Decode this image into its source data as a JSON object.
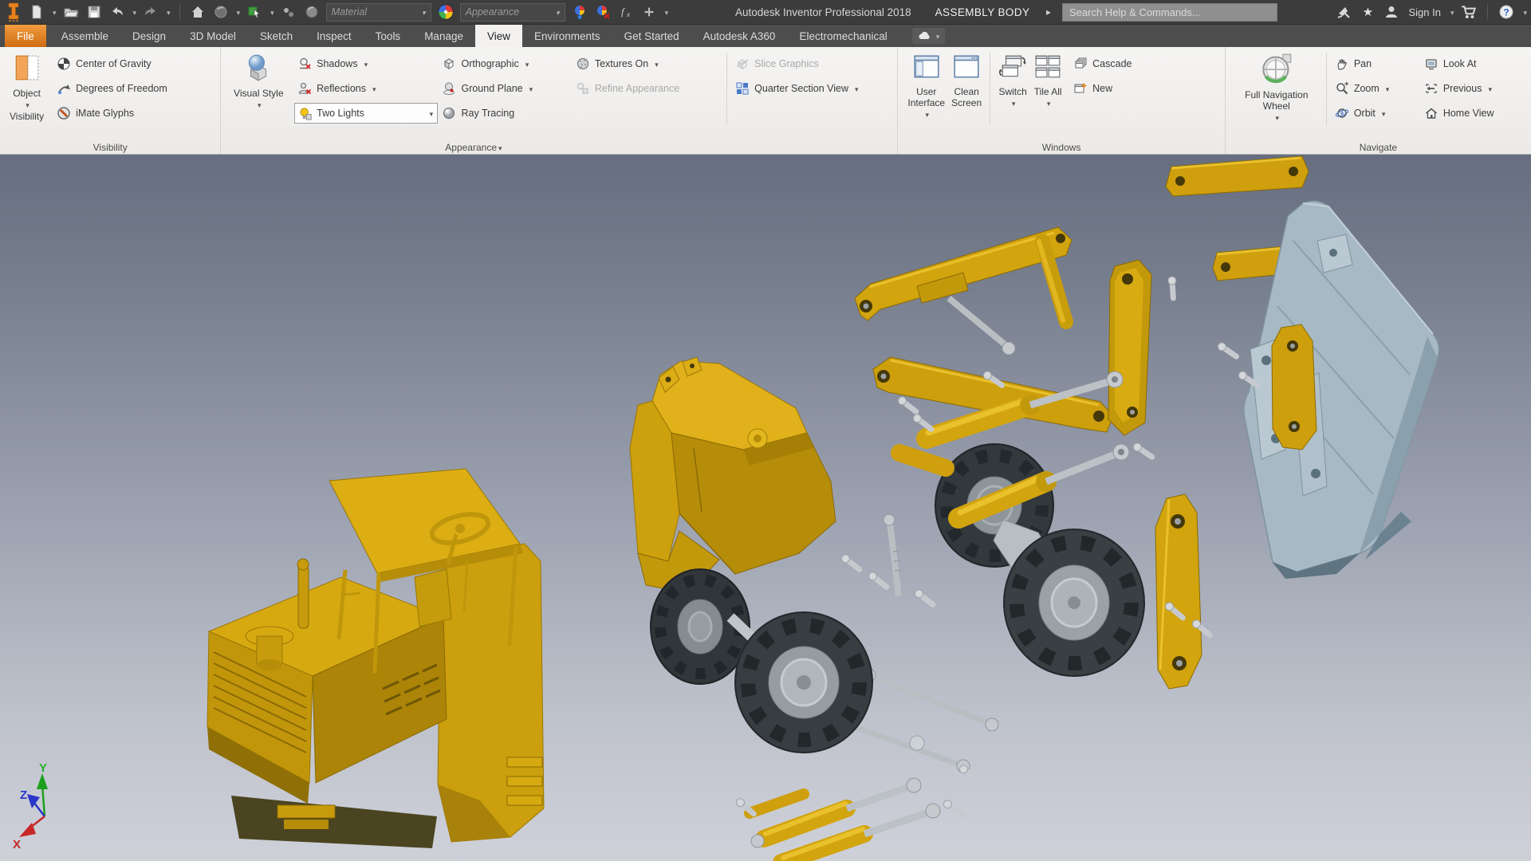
{
  "titlebar": {
    "title": "Autodesk Inventor Professional 2018",
    "document": "ASSEMBLY BODY",
    "search_placeholder": "Search Help & Commands...",
    "sign_in": "Sign In",
    "material_placeholder": "Material",
    "appearance_placeholder": "Appearance"
  },
  "tabs": {
    "file": "File",
    "assemble": "Assemble",
    "design": "Design",
    "model3d": "3D Model",
    "sketch": "Sketch",
    "inspect": "Inspect",
    "tools": "Tools",
    "manage": "Manage",
    "view": "View",
    "environments": "Environments",
    "get_started": "Get Started",
    "a360": "Autodesk A360",
    "electromech": "Electromechanical"
  },
  "ribbon": {
    "visibility": {
      "panel_label": "Visibility",
      "object_visibility_line1": "Object",
      "object_visibility_line2": "Visibility",
      "center_of_gravity": "Center of Gravity",
      "degrees_of_freedom": "Degrees of Freedom",
      "imate_glyphs": "iMate Glyphs"
    },
    "appearance": {
      "panel_label": "Appearance",
      "visual_style": "Visual Style",
      "shadows": "Shadows",
      "reflections": "Reflections",
      "lights": "Two Lights",
      "orthographic": "Orthographic",
      "ground_plane": "Ground Plane",
      "ray_tracing": "Ray Tracing",
      "textures_on": "Textures On",
      "refine_appearance": "Refine Appearance",
      "slice_graphics": "Slice Graphics",
      "quarter_section_view": "Quarter Section View"
    },
    "windows": {
      "panel_label": "Windows",
      "user_interface_line1": "User",
      "user_interface_line2": "Interface",
      "clean_screen_line1": "Clean",
      "clean_screen_line2": "Screen",
      "switch": "Switch",
      "tile_all": "Tile All",
      "cascade": "Cascade",
      "new": "New"
    },
    "navigate": {
      "panel_label": "Navigate",
      "wheel_line1": "Full Navigation",
      "wheel_line2": "Wheel",
      "pan": "Pan",
      "zoom": "Zoom",
      "orbit": "Orbit",
      "look_at": "Look At",
      "previous": "Previous",
      "home_view": "Home View"
    }
  },
  "viewport": {
    "axis_labels": {
      "x": "X",
      "y": "Y",
      "z": "Z"
    },
    "colors": {
      "machine_yellow": "#d2a40e",
      "bucket_blue_gray": "#a7b9c4",
      "tire_dark": "#33383d",
      "steel_gray": "#c0c4c9",
      "background_top": "#666e80",
      "background_bottom": "#cfd1d9"
    }
  }
}
